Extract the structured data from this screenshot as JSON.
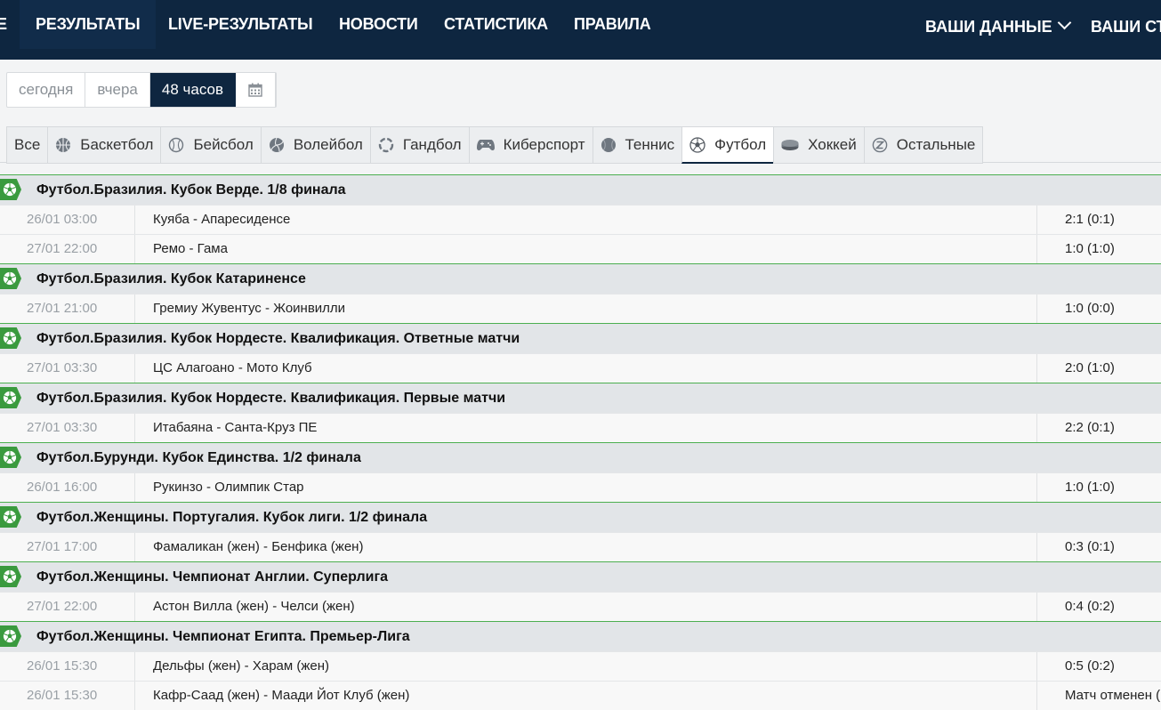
{
  "header": {
    "edge_char": "Е",
    "nav": [
      "РЕЗУЛЬТАТЫ",
      "LIVE-РЕЗУЛЬТАТЫ",
      "НОВОСТИ",
      "СТАТИСТИКА",
      "ПРАВИЛА"
    ],
    "user_menu": "ВАШИ ДАННЫЕ",
    "user_menu_2": "ВАШИ СТА"
  },
  "period": {
    "today": "сегодня",
    "yesterday": "вчера",
    "hours48": "48 часов"
  },
  "tabs": [
    "Все",
    "Баскетбол",
    "Бейсбол",
    "Волейбол",
    "Гандбол",
    "Киберспорт",
    "Теннис",
    "Футбол",
    "Хоккей",
    "Остальные"
  ],
  "active_tab": "Футбол",
  "colors": {
    "nav_bg": "#0e2640",
    "league_accent": "#3a9a3e"
  },
  "groups": [
    {
      "title": "Футбол.Бразилия. Кубок Верде. 1/8 финала",
      "matches": [
        {
          "time": "26/01 03:00",
          "teams": "Куяба - Апаресиденсе",
          "score": "2:1 (0:1)"
        },
        {
          "time": "27/01 22:00",
          "teams": "Ремо - Гама",
          "score": "1:0 (1:0)"
        }
      ]
    },
    {
      "title": "Футбол.Бразилия. Кубок Катариненсе",
      "matches": [
        {
          "time": "27/01 21:00",
          "teams": "Гремиу Жувентус - Жоинвилли",
          "score": "1:0 (0:0)"
        }
      ]
    },
    {
      "title": "Футбол.Бразилия. Кубок Нордесте. Квалификация. Ответные матчи",
      "matches": [
        {
          "time": "27/01 03:30",
          "teams": "ЦС Алагоано - Мото Клуб",
          "score": "2:0 (1:0)"
        }
      ]
    },
    {
      "title": "Футбол.Бразилия. Кубок Нордесте. Квалификация. Первые матчи",
      "matches": [
        {
          "time": "27/01 03:30",
          "teams": "Итабаяна - Санта-Круз ПЕ",
          "score": "2:2 (0:1)"
        }
      ]
    },
    {
      "title": "Футбол.Бурунди. Кубок Единства. 1/2 финала",
      "matches": [
        {
          "time": "26/01 16:00",
          "teams": "Рукинзо - Олимпик Стар",
          "score": "1:0 (1:0)"
        }
      ]
    },
    {
      "title": "Футбол.Женщины. Португалия. Кубок лиги. 1/2 финала",
      "matches": [
        {
          "time": "27/01 17:00",
          "teams": "Фамаликан (жен) - Бенфика (жен)",
          "score": "0:3 (0:1)"
        }
      ]
    },
    {
      "title": "Футбол.Женщины. Чемпионат Англии. Суперлига",
      "matches": [
        {
          "time": "27/01 22:00",
          "teams": "Астон Вилла (жен) - Челси (жен)",
          "score": "0:4 (0:2)"
        }
      ]
    },
    {
      "title": "Футбол.Женщины. Чемпионат Египта. Премьер-Лига",
      "matches": [
        {
          "time": "26/01 15:30",
          "teams": "Дельфы (жен) - Харам (жен)",
          "score": "0:5 (0:2)"
        },
        {
          "time": "26/01 15:30",
          "teams": "Кафр-Саад (жен) - Маади Йот Клуб (жен)",
          "score": "Матч отменен ("
        }
      ]
    }
  ]
}
